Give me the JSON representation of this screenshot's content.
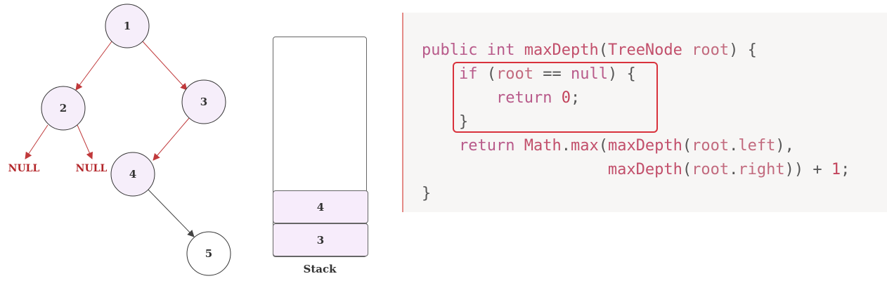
{
  "tree": {
    "nodes": [
      "1",
      "2",
      "3",
      "4",
      "5"
    ],
    "null_labels": [
      "NULL",
      "NULL"
    ],
    "colors": {
      "node_fill": "#f6eefa",
      "edge_red": "#c0393b",
      "edge_black": "#444444",
      "null_text": "#b3262a"
    }
  },
  "stack": {
    "label": "Stack",
    "frames": [
      "4",
      "3"
    ],
    "frame_fill": "#f7ecfb"
  },
  "code": {
    "lines": [
      "public int maxDepth(TreeNode root) {",
      "    if (root == null) {",
      "        return 0;",
      "    }",
      "    return Math.max(maxDepth(root.left),",
      "                    maxDepth(root.right)) + 1;",
      "}"
    ],
    "highlight_color": "#d9323c"
  }
}
